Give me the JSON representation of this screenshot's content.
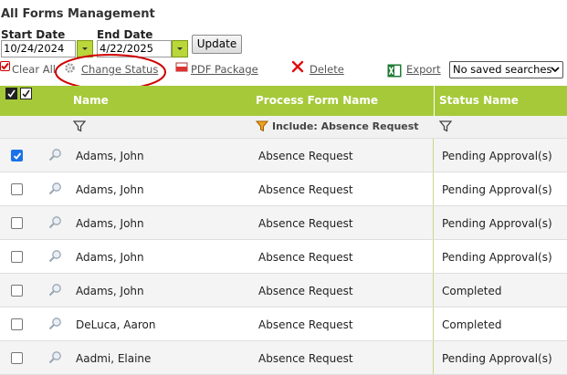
{
  "page": {
    "title": "All Forms Management"
  },
  "dates": {
    "start_label": "Start Date",
    "start_value": "10/24/2024",
    "end_label": "End Date",
    "end_value": "4/22/2025",
    "update_label": "Update"
  },
  "toolbar": {
    "clear_all": "Clear All",
    "change_status": "Change Status",
    "pdf_package": "PDF Package",
    "delete": "Delete",
    "export": "Export",
    "saved_searches": "No saved searches"
  },
  "grid": {
    "columns": {
      "name": "Name",
      "process_form": "Process Form Name",
      "status": "Status Name"
    },
    "filter_text": "Include: Absence Request",
    "accent_color": "#a6c93a",
    "rows": [
      {
        "checked": true,
        "name": "Adams, John",
        "form": "Absence Request",
        "status": "Pending Approval(s)"
      },
      {
        "checked": false,
        "name": "Adams, John",
        "form": "Absence Request",
        "status": "Pending Approval(s)"
      },
      {
        "checked": false,
        "name": "Adams, John",
        "form": "Absence Request",
        "status": "Pending Approval(s)"
      },
      {
        "checked": false,
        "name": "Adams, John",
        "form": "Absence Request",
        "status": "Pending Approval(s)"
      },
      {
        "checked": false,
        "name": "Adams, John",
        "form": "Absence Request",
        "status": "Completed"
      },
      {
        "checked": false,
        "name": "DeLuca, Aaron",
        "form": "Absence Request",
        "status": "Completed"
      },
      {
        "checked": false,
        "name": "Aadmi, Elaine",
        "form": "Absence Request",
        "status": "Pending Approval(s)"
      }
    ]
  }
}
